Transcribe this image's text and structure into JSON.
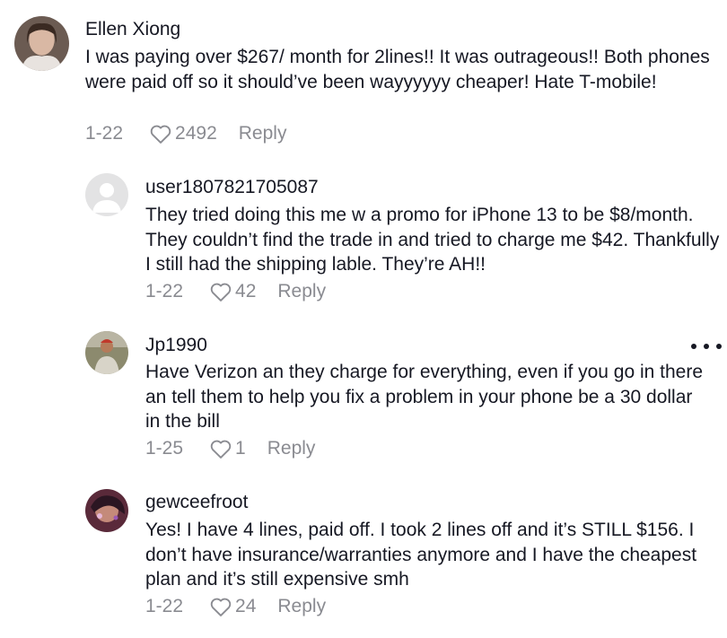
{
  "comments": [
    {
      "username": "Ellen Xiong",
      "text": "I was paying over $267/ month for 2lines!! It was outrageous!! Both phones were paid off so it should’ve been wayyyyyy cheaper! Hate T-mobile!",
      "date": "1-22",
      "likes": "2492",
      "reply_label": "Reply",
      "avatar_icon": "profile-photo"
    },
    {
      "username": "user1807821705087",
      "text": "They tried doing this me w a promo for iPhone 13 to be $8/month. They couldn’t find the trade in and tried to charge me $42. Thankfully I still had the shipping lable. They’re AH!!",
      "date": "1-22",
      "likes": "42",
      "reply_label": "Reply",
      "avatar_icon": "default-avatar-icon"
    },
    {
      "username": "Jp1990",
      "text": "Have Verizon an they charge for everything, even if you go in there an tell them to help you fix a problem in your phone be a 30 dollar in the bill",
      "date": "1-25",
      "likes": "1",
      "reply_label": "Reply",
      "avatar_icon": "profile-photo"
    },
    {
      "username": "gewceefroot",
      "text": "Yes! I have 4 lines, paid off. I took 2 lines off and it’s STILL $156. I don’t have insurance/warranties anymore and I have the cheapest plan and it’s still expensive smh",
      "date": "1-22",
      "likes": "24",
      "reply_label": "Reply",
      "avatar_icon": "profile-photo"
    }
  ],
  "icons": {
    "like": "heart-outline-icon",
    "more": "more-options-icon"
  },
  "colors": {
    "text": "#161823",
    "meta": "#8a8b91"
  }
}
